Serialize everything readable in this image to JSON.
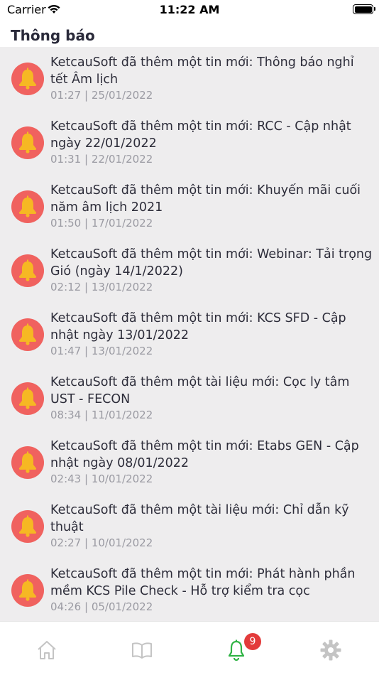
{
  "status_bar": {
    "carrier": "Carrier",
    "time": "11:22 AM"
  },
  "header": {
    "title": "Thông báo"
  },
  "notifications": [
    {
      "text": "KetcauSoft đã thêm một tin mới: Thông báo nghỉ tết Âm lịch",
      "time": "01:27 | 25/01/2022"
    },
    {
      "text": "KetcauSoft đã thêm một tin mới: RCC - Cập nhật ngày 22/01/2022",
      "time": "01:31 | 22/01/2022"
    },
    {
      "text": "KetcauSoft đã thêm một tin mới: Khuyến mãi cuối năm âm lịch 2021",
      "time": "01:50 | 17/01/2022"
    },
    {
      "text": "KetcauSoft đã thêm một tin mới: Webinar: Tải trọng Gió (ngày 14/1/2022)",
      "time": "02:12 | 13/01/2022"
    },
    {
      "text": "KetcauSoft đã thêm một tin mới: KCS SFD - Cập nhật ngày 13/01/2022",
      "time": "01:47 | 13/01/2022"
    },
    {
      "text": "KetcauSoft đã thêm một tài liệu mới: Cọc ly tâm UST - FECON",
      "time": "08:34 | 11/01/2022"
    },
    {
      "text": "KetcauSoft đã thêm một tin mới: Etabs GEN - Cập nhật ngày 08/01/2022",
      "time": "02:43 | 10/01/2022"
    },
    {
      "text": "KetcauSoft đã thêm một tài liệu mới: Chỉ dẫn kỹ thuật",
      "time": "02:27 | 10/01/2022"
    },
    {
      "text": "KetcauSoft đã thêm một tin mới: Phát hành phần mềm KCS Pile Check - Hỗ trợ kiểm tra cọc",
      "time": "04:26 | 05/01/2022"
    }
  ],
  "tabbar": {
    "tabs": [
      {
        "icon": "home-icon"
      },
      {
        "icon": "book-icon"
      },
      {
        "icon": "bell-icon",
        "active": true,
        "badge": "9"
      },
      {
        "icon": "gear-icon"
      }
    ],
    "active_color": "#2fb344",
    "inactive_color": "#c4c4c4"
  },
  "colors": {
    "icon_bg": "#f0625f",
    "bell": "#f6b823",
    "badge": "#e33b3b"
  }
}
